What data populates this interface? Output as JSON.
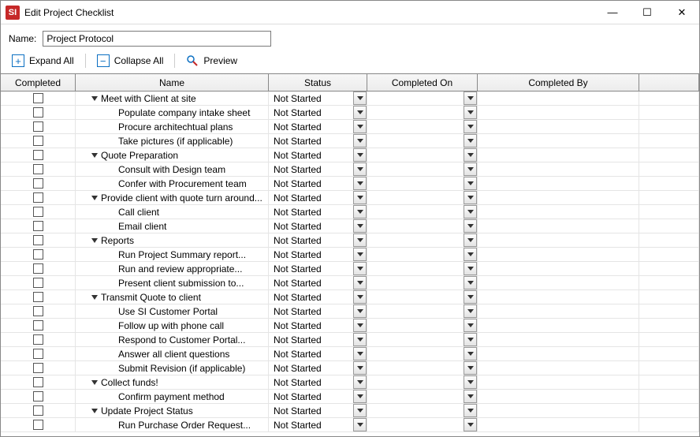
{
  "window": {
    "title": "Edit Project Checklist",
    "app_icon_text": "SI"
  },
  "form": {
    "name_label": "Name:",
    "name_value": "Project Protocol"
  },
  "toolbar": {
    "expand_all": "Expand All",
    "collapse_all": "Collapse All",
    "preview": "Preview"
  },
  "columns": {
    "completed": "Completed",
    "name": "Name",
    "status": "Status",
    "completed_on": "Completed On",
    "completed_by": "Completed By"
  },
  "status_default": "Not Started",
  "rows": [
    {
      "level": 0,
      "expander": true,
      "name": "Meet with Client at site",
      "status": "Not Started"
    },
    {
      "level": 1,
      "expander": false,
      "name": "Populate company intake sheet",
      "status": "Not Started"
    },
    {
      "level": 1,
      "expander": false,
      "name": "Procure architechtual plans",
      "status": "Not Started"
    },
    {
      "level": 1,
      "expander": false,
      "name": "Take pictures (if applicable)",
      "status": "Not Started"
    },
    {
      "level": 0,
      "expander": true,
      "name": "Quote Preparation",
      "status": "Not Started"
    },
    {
      "level": 1,
      "expander": false,
      "name": "Consult with Design team",
      "status": "Not Started"
    },
    {
      "level": 1,
      "expander": false,
      "name": "Confer with Procurement team",
      "status": "Not Started"
    },
    {
      "level": 0,
      "expander": true,
      "name": "Provide client with quote turn around...",
      "status": "Not Started"
    },
    {
      "level": 1,
      "expander": false,
      "name": "Call client",
      "status": "Not Started"
    },
    {
      "level": 1,
      "expander": false,
      "name": "Email client",
      "status": "Not Started"
    },
    {
      "level": 0,
      "expander": true,
      "name": "Reports",
      "status": "Not Started"
    },
    {
      "level": 1,
      "expander": false,
      "name": "Run Project Summary report...",
      "status": "Not Started"
    },
    {
      "level": 1,
      "expander": false,
      "name": "Run and review appropriate...",
      "status": "Not Started"
    },
    {
      "level": 1,
      "expander": false,
      "name": "Present client submission to...",
      "status": "Not Started"
    },
    {
      "level": 0,
      "expander": true,
      "name": "Transmit Quote to client",
      "status": "Not Started"
    },
    {
      "level": 1,
      "expander": false,
      "name": "Use SI Customer Portal",
      "status": "Not Started"
    },
    {
      "level": 1,
      "expander": false,
      "name": "Follow up with phone call",
      "status": "Not Started"
    },
    {
      "level": 1,
      "expander": false,
      "name": "Respond to Customer Portal...",
      "status": "Not Started"
    },
    {
      "level": 1,
      "expander": false,
      "name": "Answer all client questions",
      "status": "Not Started"
    },
    {
      "level": 1,
      "expander": false,
      "name": "Submit Revision (if applicable)",
      "status": "Not Started"
    },
    {
      "level": 0,
      "expander": true,
      "name": "Collect funds!",
      "status": "Not Started"
    },
    {
      "level": 1,
      "expander": false,
      "name": "Confirm payment method",
      "status": "Not Started"
    },
    {
      "level": 0,
      "expander": true,
      "name": "Update Project Status",
      "status": "Not Started"
    },
    {
      "level": 1,
      "expander": false,
      "name": "Run Purchase Order Request...",
      "status": "Not Started"
    }
  ]
}
